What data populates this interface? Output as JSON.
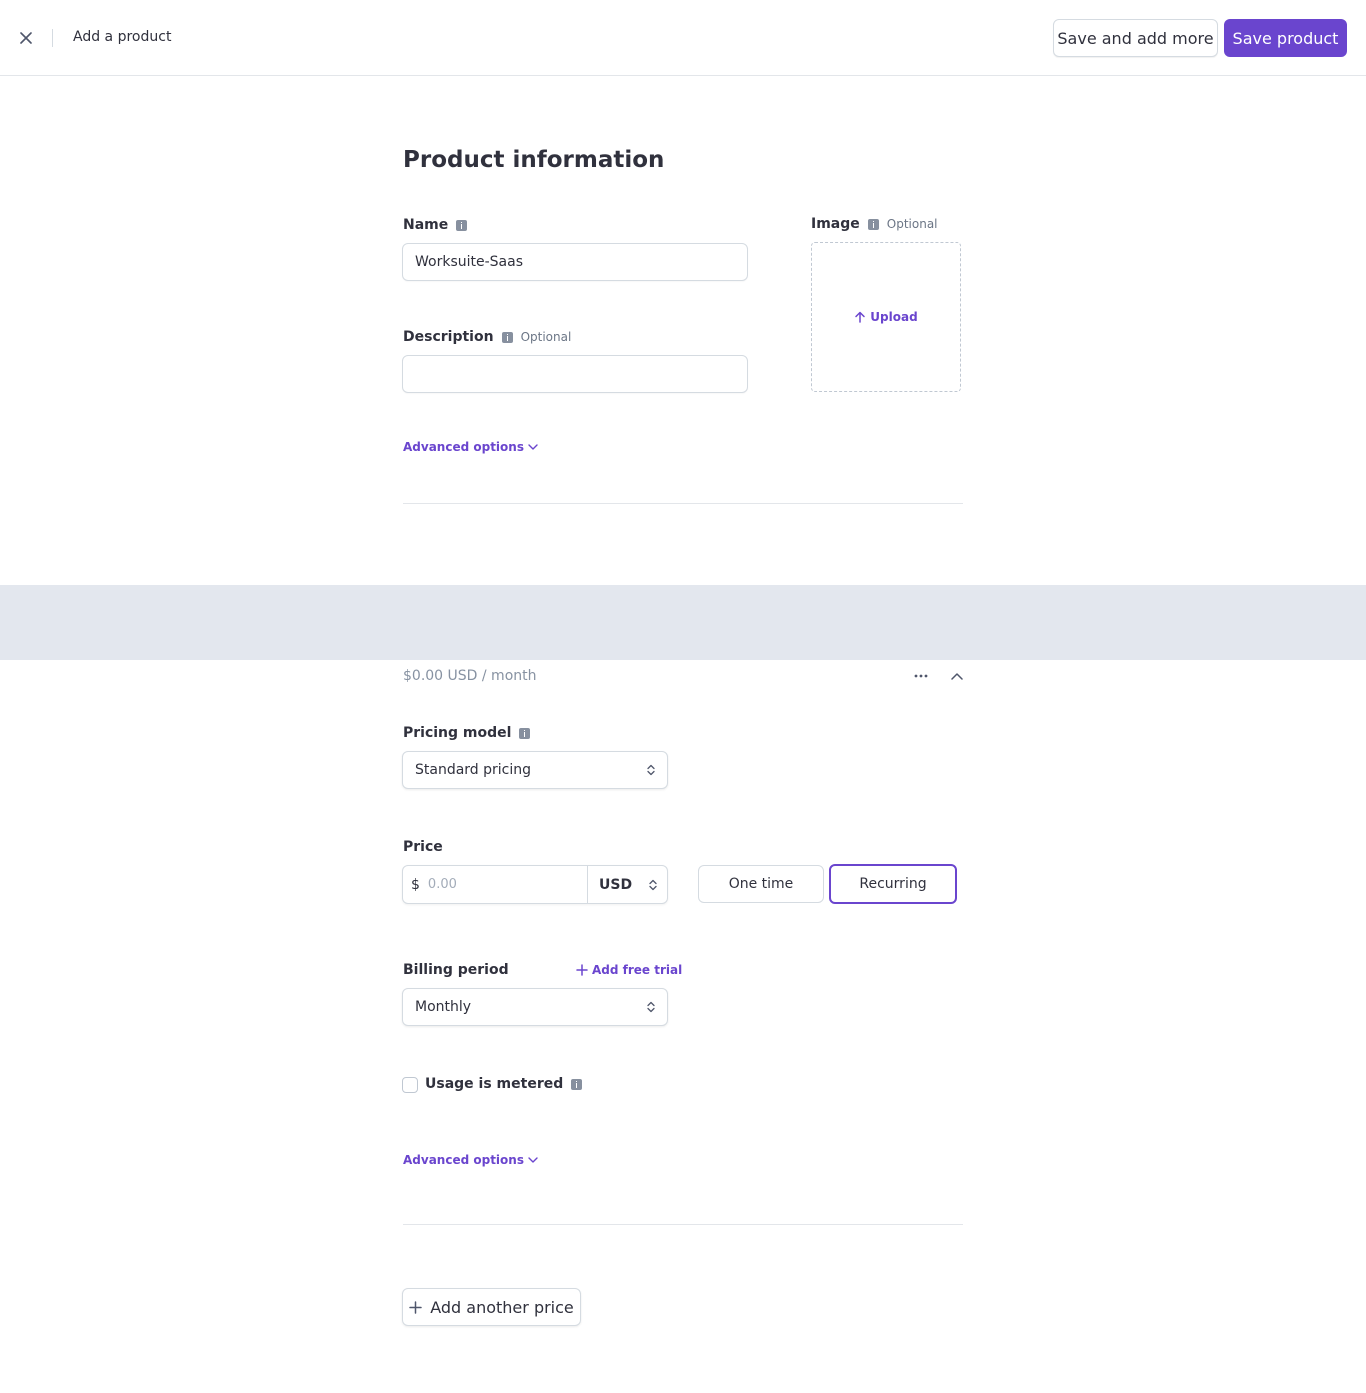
{
  "header": {
    "title": "Add a product",
    "save_more_label": "Save and add more",
    "save_label": "Save product",
    "close_icon": "close-icon"
  },
  "product_info": {
    "heading": "Product information",
    "name_label": "Name",
    "name_value": "Worksuite-Saas",
    "description_label": "Description",
    "description_optional": "Optional",
    "description_value": "",
    "image_label": "Image",
    "image_optional": "Optional",
    "upload_label": "Upload",
    "advanced_options": "Advanced options"
  },
  "pricing": {
    "summary": "$0.00 USD / month",
    "pricing_model_label": "Pricing model",
    "pricing_model_value": "Standard pricing",
    "price_label": "Price",
    "currency_symbol": "$",
    "price_placeholder": "0.00",
    "currency_value": "USD",
    "one_time_label": "One time",
    "recurring_label": "Recurring",
    "selected_type": "Recurring",
    "billing_period_label": "Billing period",
    "add_free_trial": "Add free trial",
    "billing_period_value": "Monthly",
    "usage_metered_label": "Usage is metered",
    "usage_metered_checked": false,
    "advanced_options": "Advanced options",
    "add_another_price": "Add another price"
  },
  "colors": {
    "accent": "#6a45ce",
    "band": "#e3e7ee",
    "text": "#30313d",
    "muted": "#8792a2"
  }
}
